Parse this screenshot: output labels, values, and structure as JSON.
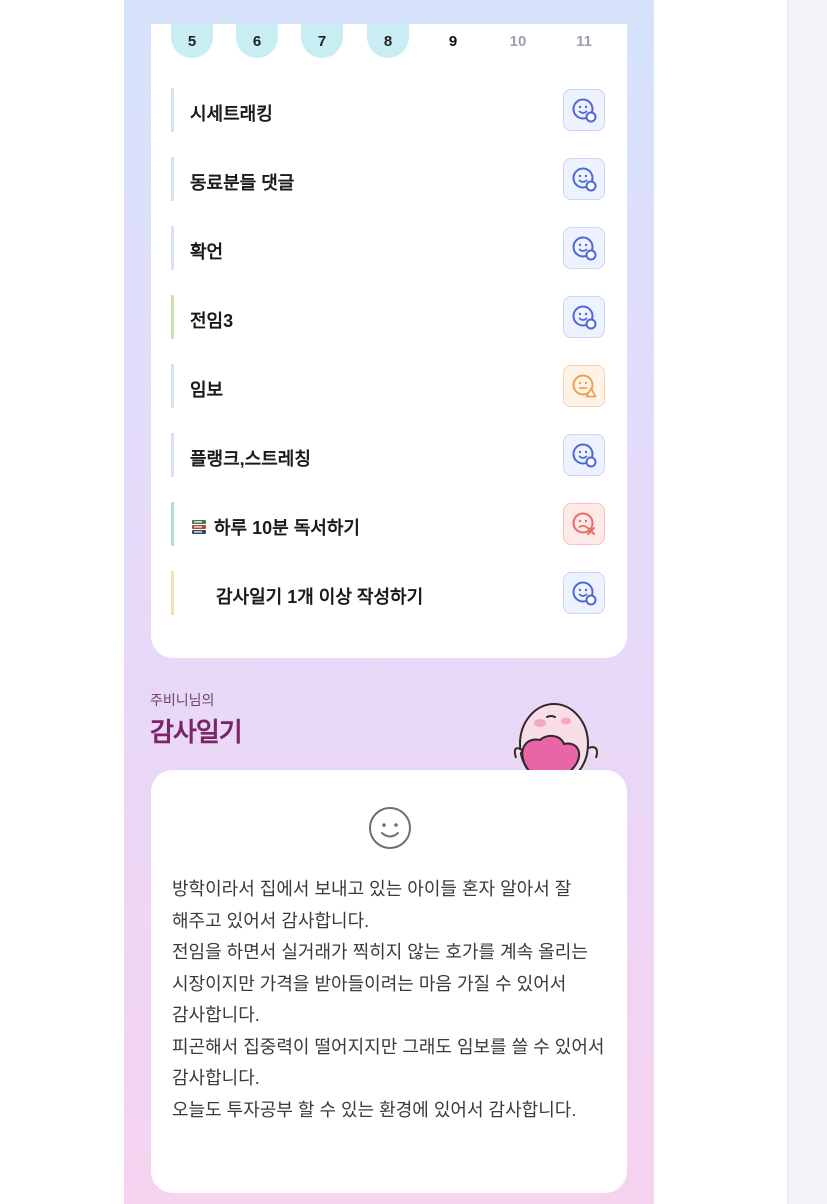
{
  "calendar": {
    "days": [
      {
        "label": "5",
        "state": "done"
      },
      {
        "label": "6",
        "state": "done"
      },
      {
        "label": "7",
        "state": "done"
      },
      {
        "label": "8",
        "state": "done"
      },
      {
        "label": "9",
        "state": "today"
      },
      {
        "label": "10",
        "state": "future"
      },
      {
        "label": "11",
        "state": "future"
      }
    ]
  },
  "habits": [
    {
      "label": "시세트래킹",
      "status": "done",
      "bar_color": "#d7e2f0"
    },
    {
      "label": "동료분들 댓글",
      "status": "done",
      "bar_color": "#d7e2f0"
    },
    {
      "label": "확언",
      "status": "done",
      "bar_color": "#d7e2f0"
    },
    {
      "label": "전임3",
      "status": "done",
      "bar_color": "#c6e6a8"
    },
    {
      "label": "임보",
      "status": "partial",
      "bar_color": "#d7e2f0"
    },
    {
      "label": "플랭크,스트레칭",
      "status": "done",
      "bar_color": "#d7e2f0"
    },
    {
      "label": "하루 10분 독서하기",
      "status": "failed",
      "bar_color": "#a9e4d9",
      "icon": "books-icon"
    },
    {
      "label": "감사일기 1개 이상 작성하기",
      "status": "done",
      "bar_color": "#f7e0b0"
    }
  ],
  "diary": {
    "owner": "주비니님의",
    "title": "감사일기",
    "text": "방학이라서 집에서 보내고 있는 아이들 혼자 알아서 잘 해주고 있어서 감사합니다.\n전임을 하면서 실거래가 찍히지 않는 호가를 계속 올리는 시장이지만 가격을 받아들이려는 마음 가질 수 있어서 감사합니다.\n피곤해서 집중력이 떨어지지만 그래도 임보를 쓸 수 있어서 감사합니다.\n오늘도 투자공부 할 수 있는 환경에 있어서 감사합니다."
  },
  "colors": {
    "done_day_bg": "#c8eef3",
    "status_done": "#4a68d8",
    "status_partial": "#f0a050",
    "status_failed": "#e86a62",
    "diary_title": "#7b2467"
  }
}
